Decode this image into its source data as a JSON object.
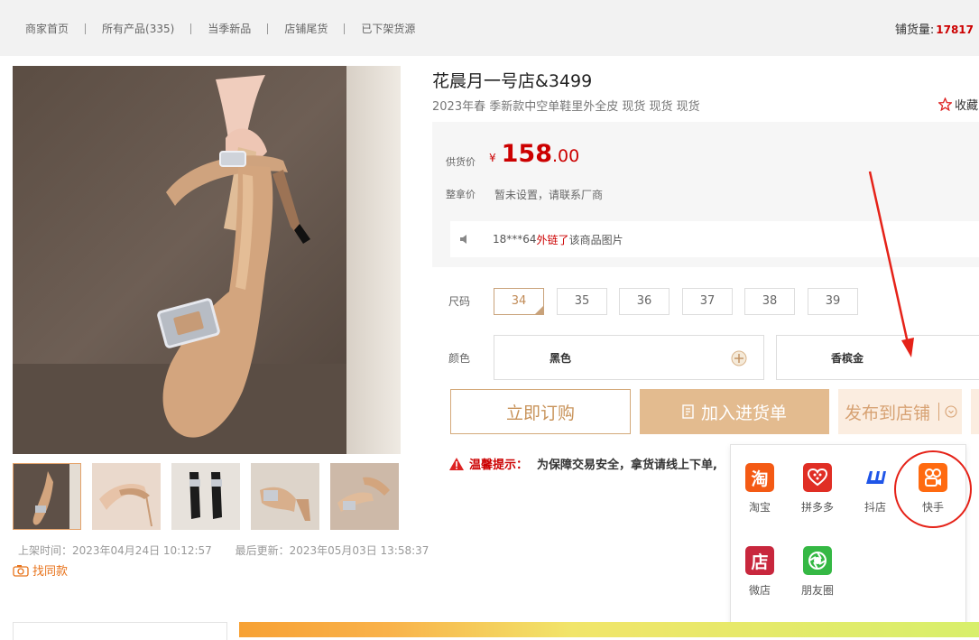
{
  "nav": {
    "items": [
      "商家首页",
      "所有产品(335)",
      "当季新品",
      "店铺尾货",
      "已下架货源"
    ],
    "stock_label": "铺货量:",
    "stock_value": "17817"
  },
  "product": {
    "title": "花晨月一号店&3499",
    "subtitle": "2023年春 季新款中空单鞋里外全皮 现货 现货 现货",
    "favorite_label": "收藏",
    "price_label": "供货价",
    "currency": "¥",
    "price_int": "158",
    "price_dec": ".00",
    "wholesale_label": "整拿价",
    "wholesale_value": "暂未设置，请联系厂商",
    "notice": {
      "user": "18***64",
      "action": "外链了",
      "rest": "该商品图片"
    },
    "size_label": "尺码",
    "sizes": [
      "34",
      "35",
      "36",
      "37",
      "38",
      "39"
    ],
    "selected_size": "34",
    "color_label": "颜色",
    "colors": [
      "黑色",
      "香槟金"
    ],
    "listed_time": "上架时间：2023年04月24日 10:12:57",
    "updated_time": "最后更新：2023年05月03日 13:58:37",
    "find_same": "找同款"
  },
  "actions": {
    "order": "立即订购",
    "cart": "加入进货单",
    "publish": "发布到店铺"
  },
  "warning": {
    "title": "温馨提示：",
    "text": "为保障交易安全，拿货请线上下单,"
  },
  "platforms": [
    {
      "name": "淘宝",
      "glyph": "淘",
      "color": "#f45a14"
    },
    {
      "name": "拼多多",
      "glyph": "",
      "color": "#e02e24"
    },
    {
      "name": "抖店",
      "glyph": "",
      "color": "#1f55e8"
    },
    {
      "name": "快手",
      "glyph": "",
      "color": "#ff6a10"
    },
    {
      "name": "微店",
      "glyph": "店",
      "color": "#c8273d"
    },
    {
      "name": "朋友圈",
      "glyph": "",
      "color": "#35b844"
    }
  ]
}
